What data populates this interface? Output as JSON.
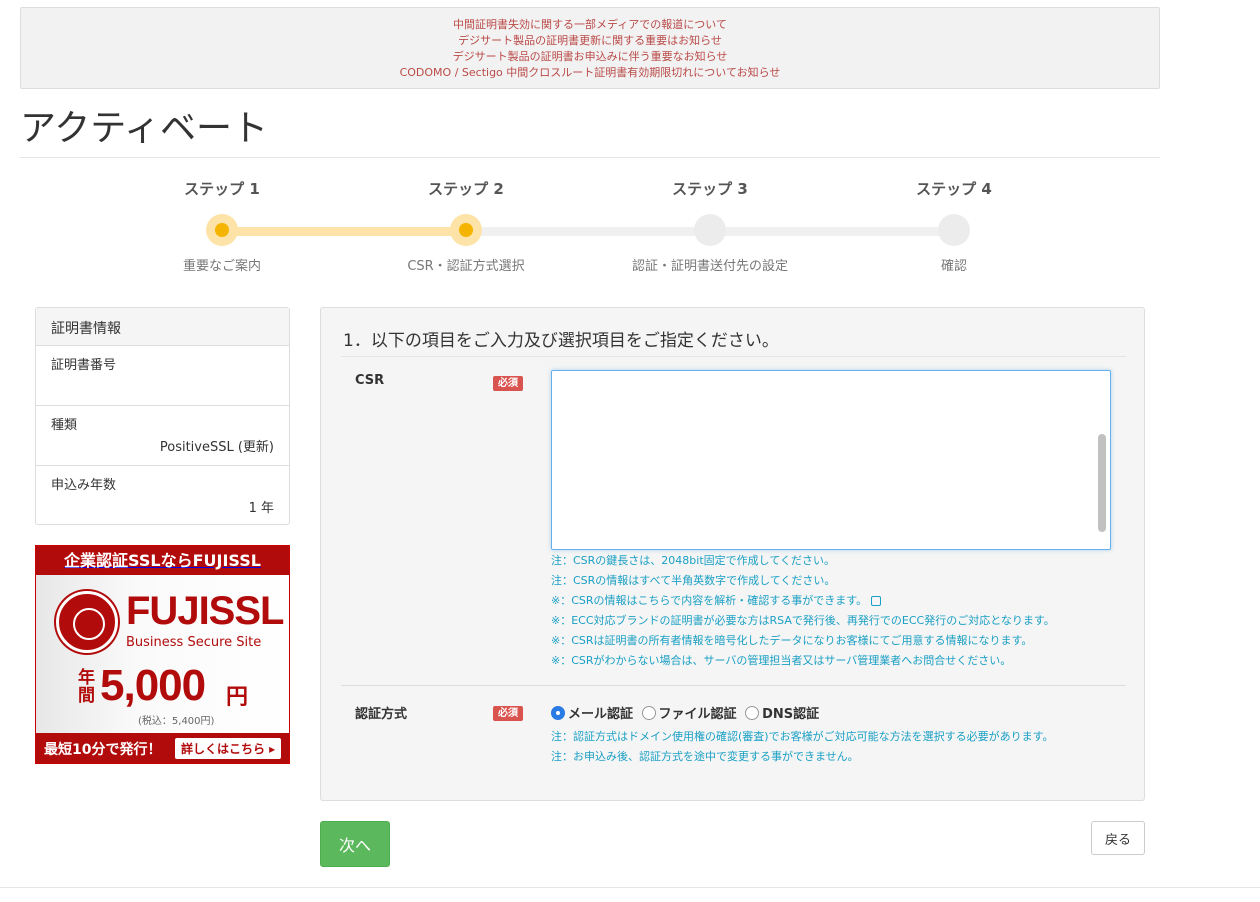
{
  "notices": [
    "中間証明書失効に関する一部メディアでの報道について",
    "デジサート製品の証明書更新に関する重要はお知らせ",
    "デジサート製品の証明書お申込みに伴う重要なお知らせ",
    "CODOMO / Sectigo 中間クロスルート証明書有効期限切れについてお知らせ"
  ],
  "page_title": "アクティベート",
  "steps": [
    {
      "name": "ステップ 1",
      "desc": "重要なご案内",
      "state": "done"
    },
    {
      "name": "ステップ 2",
      "desc": "CSR・認証方式選択",
      "state": "current"
    },
    {
      "name": "ステップ 3",
      "desc": "認証・証明書送付先の設定",
      "state": "todo"
    },
    {
      "name": "ステップ 4",
      "desc": "確認",
      "state": "todo"
    }
  ],
  "cert_info": {
    "heading": "証明書情報",
    "number_label": "証明書番号",
    "number_value": "",
    "type_label": "種類",
    "type_value": "PositiveSSL (更新)",
    "years_label": "申込み年数",
    "years_value": "1 年"
  },
  "banner": {
    "top": "企業認証SSLならFUJISSL",
    "brand": "FUJISSL",
    "tagline": "Business Secure Site",
    "per_year": "年間",
    "price": "5,000",
    "yen": "円",
    "tax": "(税込：5,400円)",
    "fast": "最短10分で発行！",
    "detail": "詳しくはこちら ▸"
  },
  "form": {
    "heading": "1．以下の項目をご入力及び選択項目をご指定ください。",
    "required": "必須",
    "csr_label": "CSR",
    "csr_value": "",
    "csr_notes": [
      "注：CSRの鍵長さは、2048bit固定で作成してください。",
      "注：CSRの情報はすべて半角英数字で作成してください。",
      "※：CSRの情報はこちらで内容を解析・確認する事ができます。",
      "※：ECC対応ブランドの証明書が必要な方はRSAで発行後、再発行でのECC発行のご対応となります。",
      "※：CSRは証明書の所有者情報を暗号化したデータになりお客様にてご用意する情報になります。",
      "※：CSRがわからない場合は、サーバの管理担当者又はサーバ管理業者へお問合せください。"
    ],
    "auth_label": "認証方式",
    "auth_options": [
      {
        "label": "メール認証",
        "selected": true
      },
      {
        "label": "ファイル認証",
        "selected": false
      },
      {
        "label": "DNS認証",
        "selected": false
      }
    ],
    "auth_notes": [
      "注：認証方式はドメイン使用権の確認(審査)でお客様がご対応可能な方法を選択する必要があります。",
      "注：お申込み後、認証方式を途中で変更する事ができません。"
    ]
  },
  "buttons": {
    "next": "次へ",
    "back": "戻る"
  }
}
